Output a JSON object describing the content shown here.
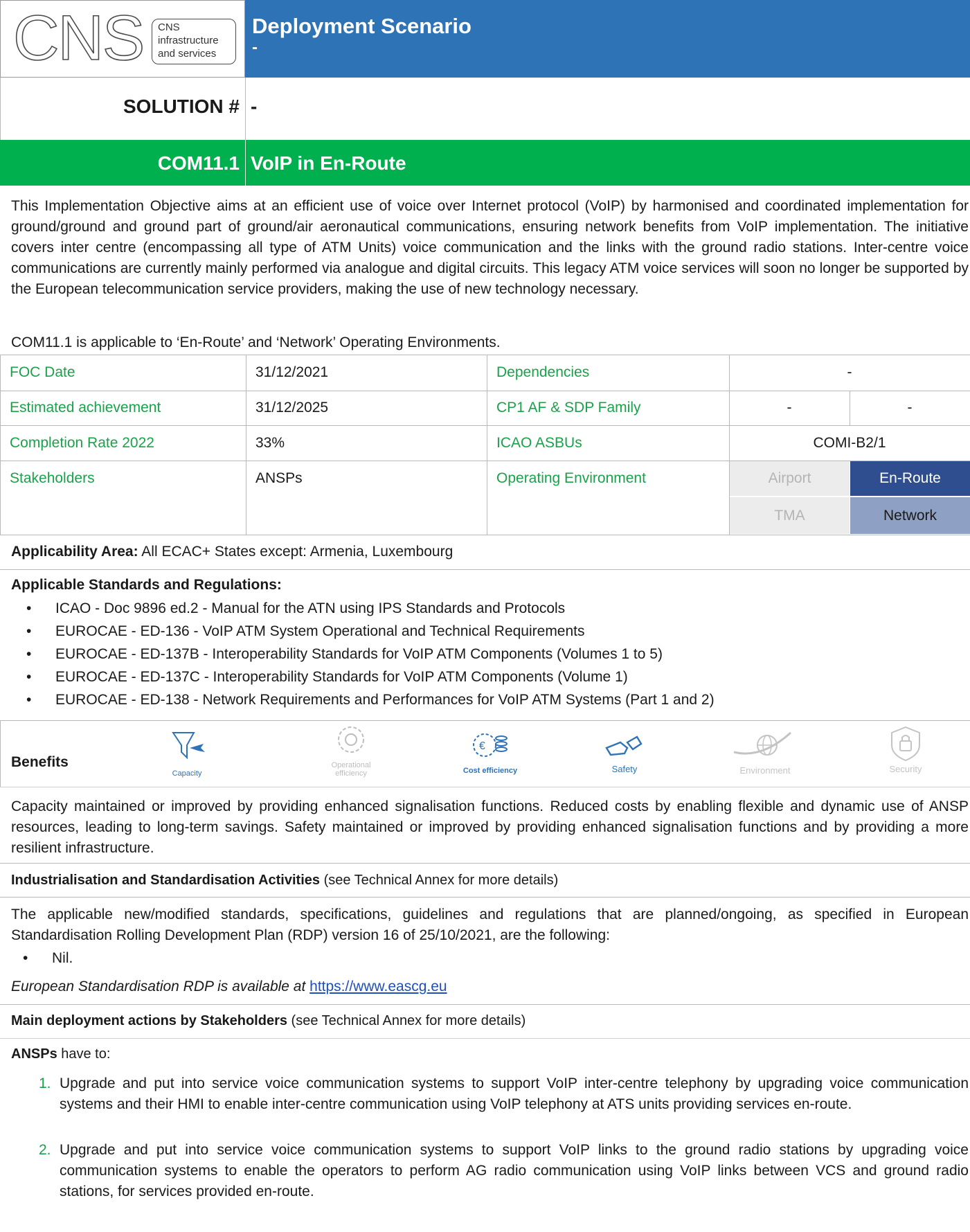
{
  "header": {
    "logo_letters": "CNS",
    "logo_subtitle": [
      "CNS",
      "infrastructure",
      "and services"
    ],
    "title": "Deployment Scenario",
    "title_sub": "-"
  },
  "solution": {
    "label": "SOLUTION #",
    "value": "-"
  },
  "objective": {
    "code": "COM11.1",
    "title": "VoIP in En-Route"
  },
  "description": "This Implementation Objective aims at an efficient use of voice over Internet protocol (VoIP) by harmonised and coordinated implementation for ground/ground and ground part of ground/air aeronautical communications, ensuring network benefits from VoIP implementation. The initiative covers inter centre (encompassing all type of ATM Units) voice communication and the links with the ground radio stations. Inter-centre voice communications are currently mainly performed via analogue and digital circuits. This legacy ATM voice services will soon no longer be supported by the European telecommunication service providers, making the use of new technology necessary.",
  "applicability_note": "COM11.1 is applicable to ‘En-Route’ and ‘Network’ Operating Environments.",
  "info_table": {
    "foc_label": "FOC Date",
    "foc_value": "31/12/2021",
    "dep_label": "Dependencies",
    "dep_value": "-",
    "est_label": "Estimated achievement",
    "est_value": "31/12/2025",
    "cp1_label": "CP1 AF & SDP Family",
    "cp1_value1": "-",
    "cp1_value2": "-",
    "comp_label": "Completion Rate 2022",
    "comp_value": "33%",
    "icao_label": "ICAO ASBUs",
    "icao_value": "COMI-B2/1",
    "stake_label": "Stakeholders",
    "stake_value": "ANSPs",
    "env_label": "Operating Environment",
    "env": {
      "airport": "Airport",
      "enroute": "En-Route",
      "tma": "TMA",
      "network": "Network"
    },
    "env_colors": {
      "enroute": "#2f4e8f",
      "network": "#8ea0c4",
      "inactive_bg": "#ececec",
      "inactive_text": "#b4b4b4"
    }
  },
  "applicability_area": {
    "label": "Applicability Area:",
    "value": " All ECAC+ States except: Armenia, Luxembourg"
  },
  "standards": {
    "heading": "Applicable Standards and Regulations:",
    "items": [
      "ICAO - Doc 9896 ed.2 - Manual for the ATN using IPS Standards and Protocols",
      "EUROCAE - ED-136 - VoIP ATM System Operational and Technical Requirements",
      "EUROCAE - ED-137B - Interoperability Standards for VoIP ATM Components (Volumes 1 to 5)",
      "EUROCAE - ED-137C - Interoperability Standards for VoIP ATM Components (Volume 1)",
      "EUROCAE - ED-138 - Network Requirements and Performances for VoIP ATM Systems (Part 1 and 2)"
    ]
  },
  "benefits": {
    "label": "Benefits",
    "icons": [
      {
        "name": "capacity-icon",
        "label": "Capacity",
        "active": true
      },
      {
        "name": "operational-efficiency-icon",
        "label": "Operational efficiency",
        "active": false
      },
      {
        "name": "cost-efficiency-icon",
        "label": "Cost efficiency",
        "active": true
      },
      {
        "name": "safety-icon",
        "label": "Safety",
        "active": true
      },
      {
        "name": "environment-icon",
        "label": "Environment",
        "active": false
      },
      {
        "name": "security-icon",
        "label": "Security",
        "active": false
      }
    ],
    "op_eff_line1": "Operational",
    "op_eff_line2": "efficiency",
    "text": "Capacity maintained or improved by providing enhanced signalisation functions. Reduced costs by enabling flexible and dynamic use of ANSP resources, leading to long-term savings. Safety maintained or improved by providing enhanced signalisation functions and by providing a more resilient infrastructure."
  },
  "industrialisation": {
    "heading": "Industrialisation and Standardisation Activities",
    "heading_note": " (see Technical Annex for more details)",
    "text": "The applicable new/modified standards, specifications, guidelines and regulations that are planned/ongoing, as specified in European Standardisation Rolling Development Plan (RDP) version 16 of 25/10/2021, are the following:",
    "items": [
      "Nil."
    ],
    "rdp_note": "European Standardisation RDP is available at",
    "rdp_link": "https://www.eascg.eu"
  },
  "actions": {
    "heading": "Main deployment actions by Stakeholders",
    "heading_note": " (see Technical Annex for more details)",
    "stakeholder": "ANSPs",
    "stakeholder_suffix": " have to:",
    "items": [
      {
        "num": "1.",
        "text": "Upgrade and put into service voice communication systems to support VoIP inter-centre telephony by upgrading voice communication systems and their HMI to enable inter-centre communication using VoIP telephony at ATS units providing services en-route."
      },
      {
        "num": "2.",
        "text": "Upgrade and put into service voice communication systems to support VoIP links to the ground radio stations by upgrading voice communication systems to enable the operators to perform AG radio communication using VoIP links between VCS and ground radio stations, for services provided en-route."
      }
    ]
  }
}
